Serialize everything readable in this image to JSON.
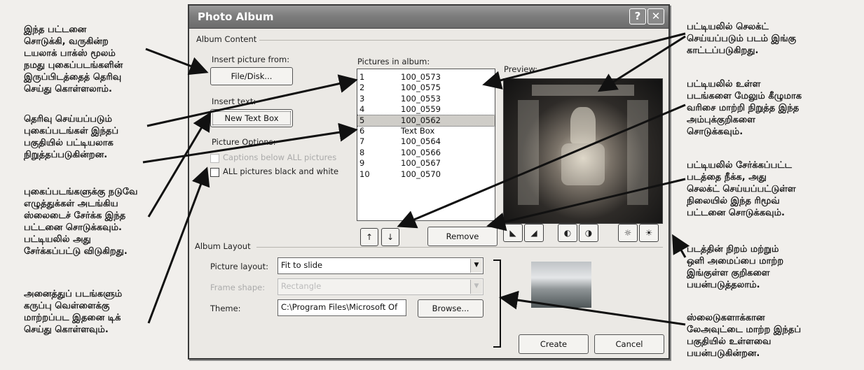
{
  "dialog": {
    "title": "Photo Album",
    "help_glyph": "?",
    "close_glyph": "✕",
    "album_content": {
      "group_label": "Album Content",
      "insert_picture_label": "Insert picture from:",
      "file_disk_button": "File/Disk...",
      "insert_text_label": "Insert text:",
      "new_text_box_button": "New Text Box",
      "picture_options_label": "Picture Options:",
      "captions_option": "Captions below ALL pictures",
      "black_white_option": "ALL pictures black and white",
      "black_white_checked": false
    },
    "pictures_list": {
      "label": "Pictures in album:",
      "selected_index": 4,
      "items": [
        {
          "num": "1",
          "name": "100_0573"
        },
        {
          "num": "2",
          "name": "100_0575"
        },
        {
          "num": "3",
          "name": "100_0553"
        },
        {
          "num": "4",
          "name": "100_0559"
        },
        {
          "num": "5",
          "name": "100_0562"
        },
        {
          "num": "6",
          "name": "Text Box"
        },
        {
          "num": "7",
          "name": "100_0564"
        },
        {
          "num": "8",
          "name": "100_0566"
        },
        {
          "num": "9",
          "name": "100_0567"
        },
        {
          "num": "10",
          "name": "100_0570"
        }
      ]
    },
    "preview_label": "Preview:",
    "move_up_glyph": "↑",
    "move_down_glyph": "↓",
    "remove_button": "Remove",
    "image_tools": {
      "rotate_left_icon": "rotate-left-icon",
      "rotate_right_icon": "rotate-right-icon",
      "more_contrast_icon": "more-contrast-icon",
      "less_contrast_icon": "less-contrast-icon",
      "more_brightness_icon": "more-brightness-icon",
      "less_brightness_icon": "less-brightness-icon"
    },
    "album_layout": {
      "group_label": "Album Layout",
      "picture_layout_label": "Picture layout:",
      "picture_layout_value": "Fit to slide",
      "frame_shape_label": "Frame shape:",
      "frame_shape_value": "Rectangle",
      "theme_label": "Theme:",
      "theme_value": "C:\\Program Files\\Microsoft Of",
      "browse_button": "Browse..."
    },
    "create_button": "Create",
    "cancel_button": "Cancel"
  },
  "annotations": {
    "left_1": "இந்த பட்டனை\nசொடுக்கி, வருகின்ற\nடயலாக் பாக்ஸ் மூலம்\nநமது புகைப்படங்களின்\nஇருப்பிடத்தைத் தெரிவு\nசெய்து கொள்ளலாம்.",
    "left_2": "தெரிவு செய்யப்படும்\nபுகைப்படங்கள் இந்தப்\nபகுதியில் பட்டியலாக\nநிறுத்தப்படுகின்றன.",
    "left_3": "புகைப்படங்களுக்கு நடுவே\nஎழுத்துக்கள் அடங்கிய\nஸ்லைடைச் சேர்க்க இந்த\nபட்டனை சொடுக்கவும்.\nபட்டியலில் அது\nசேர்க்கப்பட்டு விடுகிறது.",
    "left_4": "அனைத்துப் படங்களும்\nகருப்பு வெள்ளைக்கு\nமாற்றப்பட இதனை டிக்\nசெய்து கொள்ளவும்.",
    "right_1": "பட்டியலில் செலக்ட்\nசெய்யப்படும் படம் இங்கு\nகாட்டப்படுகிறது.",
    "right_2": "பட்டியலில் உள்ள\nபடங்களை மேலும் கீழுமாக\nவரிசை மாற்றி நிறுத்த இந்த\nஅம்புக்குறிகளை\nசொடுக்கவும்.",
    "right_3": "பட்டியலில் சேர்க்கப்பட்ட\nபடத்தை நீக்க, அது\nசெலக்ட் செய்யப்பட்டுள்ள\nநிலையில் இந்த ரிமூவ்\nபட்டனை சொடுக்கவும்.",
    "right_4": "படத்தின் நிறம் மற்றும்\nஒளி அமைப்பை மாற்ற\nஇங்குள்ள குறிகளை\nபயன்படுத்தலாம்.",
    "right_5": "ஸ்லைடுகளாக்கான\nலேஅவுட்டை மாற்ற இந்தப்\nபகுதியில் உள்ளவை\nபயன்படுகின்றன."
  }
}
